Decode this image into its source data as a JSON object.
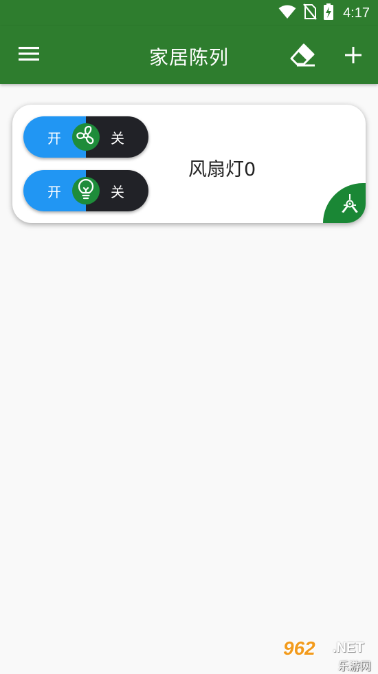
{
  "status_bar": {
    "time": "4:17",
    "icons": [
      "wifi-icon",
      "no-sim-icon",
      "battery-charging-icon"
    ]
  },
  "app_bar": {
    "title": "家居陈列",
    "icons": [
      "menu-icon",
      "eraser-icon",
      "add-icon"
    ]
  },
  "devices": [
    {
      "name": "风扇灯0",
      "controls": [
        {
          "on_label": "开",
          "off_label": "关",
          "icon": "fan-icon"
        },
        {
          "on_label": "开",
          "off_label": "关",
          "icon": "lightbulb-icon"
        }
      ],
      "badge_icon": "ceiling-fan-icon"
    }
  ],
  "watermark": {
    "number": "962",
    "domain": ".NET",
    "site_name": "乐游网"
  },
  "colors": {
    "primary": "#2e7d2e",
    "toggle_on": "#2196f3",
    "toggle_off": "#212227",
    "accent_green": "#1e8c3a",
    "background": "#f9f9f9"
  }
}
